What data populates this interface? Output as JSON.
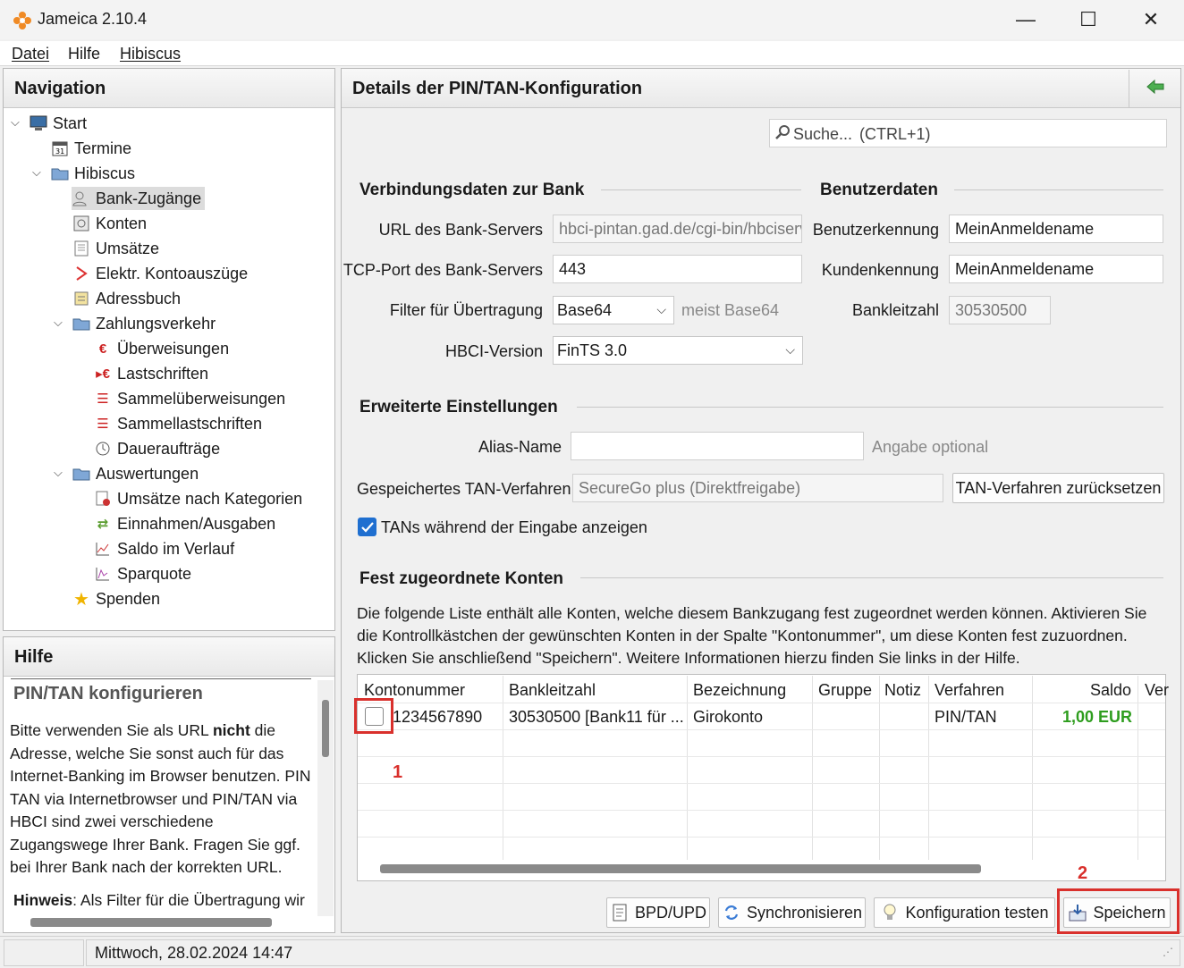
{
  "window": {
    "title": "Jameica 2.10.4",
    "minimize": "—",
    "maximize": "☐",
    "close": "✕"
  },
  "menu": {
    "items": [
      "Datei",
      "Hilfe",
      "Hibiscus"
    ]
  },
  "navigation": {
    "title": "Navigation",
    "items": {
      "start": "Start",
      "termine": "Termine",
      "hibiscus": "Hibiscus",
      "bank_zugaenge": "Bank-Zugänge",
      "konten": "Konten",
      "umsaetze": "Umsätze",
      "kontoauszuege": "Elektr. Kontoauszüge",
      "adressbuch": "Adressbuch",
      "zahlungsverkehr": "Zahlungsverkehr",
      "ueberweisungen": "Überweisungen",
      "lastschriften": "Lastschriften",
      "sammelueberweisungen": "Sammelüberweisungen",
      "sammellastschriften": "Sammellastschriften",
      "dauerauftraege": "Daueraufträge",
      "auswertungen": "Auswertungen",
      "umsaetze_kategorien": "Umsätze nach Kategorien",
      "einnahmen_ausgaben": "Einnahmen/Ausgaben",
      "saldo_verlauf": "Saldo im Verlauf",
      "sparquote": "Sparquote",
      "spenden": "Spenden"
    }
  },
  "help": {
    "title": "Hilfe",
    "heading": "PIN/TAN konfigurieren",
    "p1_pre": "Bitte verwenden Sie als URL ",
    "p1_bold": "nicht",
    "p1_post": " die Adresse, welche Sie sonst auch für das Internet-Banking im Browser benutzen. PIN TAN via Internetbrowser und PIN/TAN via HBCI sind zwei verschiedene Zugangswege Ihrer Bank. Fragen Sie ggf. bei Ihrer Bank nach der korrekten URL.",
    "p2_bold": "Hinweis",
    "p2_post": ": Als Filter für die Übertragung wir"
  },
  "details": {
    "title": "Details der PIN/TAN-Konfiguration",
    "search_placeholder": "Suche...",
    "search_shortcut": "(CTRL+1)",
    "connection": {
      "heading": "Verbindungsdaten zur Bank",
      "url_label": "URL des Bank-Servers",
      "url_value": "hbci-pintan.gad.de/cgi-bin/hbciservlet",
      "port_label": "TCP-Port des Bank-Servers",
      "port_value": "443",
      "filter_label": "Filter für Übertragung",
      "filter_value": "Base64",
      "filter_hint": "meist Base64",
      "hbci_label": "HBCI-Version",
      "hbci_value": "FinTS 3.0"
    },
    "user": {
      "heading": "Benutzerdaten",
      "userid_label": "Benutzerkennung",
      "userid_value": "MeinAnmeldename",
      "customer_label": "Kundenkennung",
      "customer_value": "MeinAnmeldename",
      "blz_label": "Bankleitzahl",
      "blz_value": "30530500"
    },
    "advanced": {
      "heading": "Erweiterte Einstellungen",
      "alias_label": "Alias-Name",
      "alias_value": "",
      "alias_hint": "Angabe optional",
      "tan_label": "Gespeichertes TAN-Verfahren",
      "tan_value": "SecureGo plus (Direktfreigabe)",
      "tan_reset": "TAN-Verfahren zurücksetzen",
      "show_tans_label": "TANs während der Eingabe anzeigen"
    },
    "accounts": {
      "heading": "Fest zugeordnete Konten",
      "desc1": "Die folgende Liste enthält alle Konten, welche diesem Bankzugang fest zugeordnet werden können. Aktivieren Sie",
      "desc2": "die Kontrollkästchen der gewünschten Konten in der Spalte \"Kontonummer\", um diese Konten fest zuzuordnen.",
      "desc3": "Klicken Sie anschließend \"Speichern\". Weitere Informationen hierzu finden Sie links in der Hilfe.",
      "columns": [
        "Kontonummer",
        "Bankleitzahl",
        "Bezeichnung",
        "Gruppe",
        "Notiz",
        "Verfahren",
        "Saldo",
        "Ver"
      ],
      "rows": [
        {
          "kontonummer": "1234567890",
          "blz": "30530500 [Bank11 für ...",
          "bezeichnung": "Girokonto",
          "gruppe": "",
          "notiz": "",
          "verfahren": "PIN/TAN",
          "saldo": "1,00 EUR"
        }
      ]
    },
    "buttons": {
      "bpd": "BPD/UPD",
      "sync": "Synchronisieren",
      "test": "Konfiguration testen",
      "save": "Speichern"
    },
    "annotations": {
      "one": "1",
      "two": "2"
    }
  },
  "status": {
    "datetime": "Mittwoch, 28.02.2024 14:47"
  },
  "colors": {
    "accent_checkbox": "#1f6fd0",
    "saldo_positive": "#2e9d1e",
    "annotation_red": "#d9302c"
  }
}
